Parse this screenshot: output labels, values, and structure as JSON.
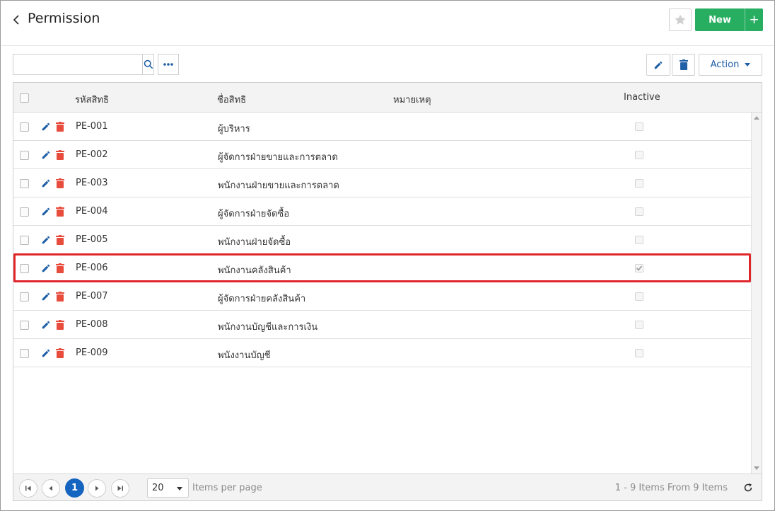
{
  "header": {
    "title": "Permission",
    "new_label": "New",
    "new_plus": "+"
  },
  "toolbar": {
    "search_placeholder": "",
    "search_value": "",
    "action_label": "Action"
  },
  "table": {
    "columns": {
      "code": "รหัสสิทธิ",
      "name": "ชื่อสิทธิ",
      "note": "หมายเหตุ",
      "inactive": "Inactive"
    },
    "rows": [
      {
        "code": "PE-001",
        "name": "ผู้บริหาร",
        "note": "",
        "inactive": false
      },
      {
        "code": "PE-002",
        "name": "ผู้จัดการฝ่ายขายและการตลาด",
        "note": "",
        "inactive": false
      },
      {
        "code": "PE-003",
        "name": "พนักงานฝ่ายขายและการตลาด",
        "note": "",
        "inactive": false
      },
      {
        "code": "PE-004",
        "name": "ผู้จัดการฝ่ายจัดซื้อ",
        "note": "",
        "inactive": false
      },
      {
        "code": "PE-005",
        "name": "พนักงานฝ่ายจัดซื้อ",
        "note": "",
        "inactive": false
      },
      {
        "code": "PE-006",
        "name": "พนักงานคลังสินค้า",
        "note": "",
        "inactive": true
      },
      {
        "code": "PE-007",
        "name": "ผู้จัดการฝ่ายคลังสินค้า",
        "note": "",
        "inactive": false
      },
      {
        "code": "PE-008",
        "name": "พนักงานบัญชีและการเงิน",
        "note": "",
        "inactive": false
      },
      {
        "code": "PE-009",
        "name": "พนังงานบัญชี",
        "note": "",
        "inactive": false
      }
    ]
  },
  "pager": {
    "current_page": "1",
    "page_size": "20",
    "per_page_label": "Items per page",
    "range_text": "1 - 9 Items From 9 Items"
  },
  "colors": {
    "primary": "#1565c0",
    "success": "#27ae60",
    "danger": "#e0262b",
    "edit_icon": "#1f5fa6",
    "trash_icon": "#e74c3c"
  }
}
